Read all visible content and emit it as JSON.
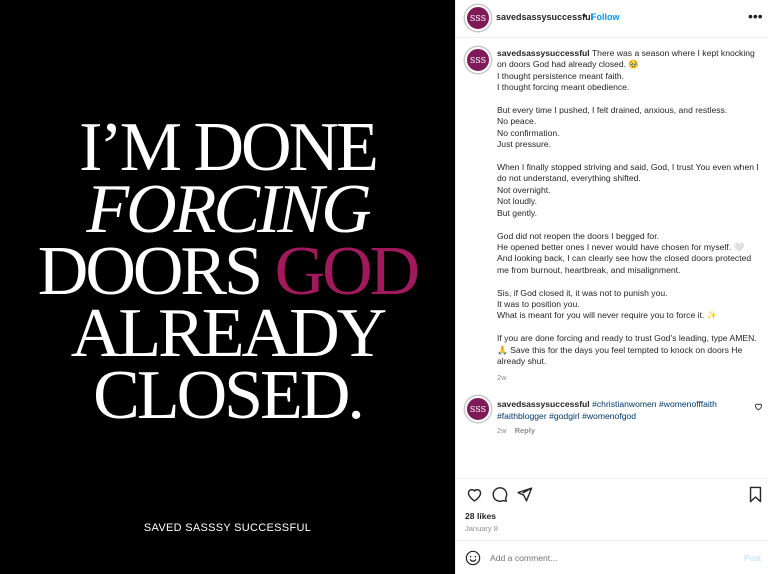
{
  "media": {
    "headline_lines": [
      "I’M DONE",
      "FORCING",
      "DOORS ",
      "GOD",
      "ALREADY",
      "CLOSED."
    ],
    "footer": "SAVED SASSSY SUCCESSFUL",
    "accent_color": "#a0195d"
  },
  "header": {
    "avatar_initials": "SSS",
    "username": "savedsassysuccessful",
    "separator": "•",
    "follow_label": "Follow",
    "more_icon": "more-horizontal-icon"
  },
  "caption": {
    "username": "savedsassysuccessful",
    "text": " There was a season where I kept knocking on doors God had already closed. 🥹\nI thought persistence meant faith.\nI thought forcing meant obedience.\n\nBut every time I pushed, I felt drained, anxious, and restless.\nNo peace.\nNo confirmation.\nJust pressure.\n\nWhen I finally stopped striving and said, God, I trust You even when I do not understand, everything shifted.\nNot overnight.\nNot loudly.\nBut gently.\n\nGod did not reopen the doors I begged for.\nHe opened better ones I never would have chosen for myself. 🤍\nAnd looking back, I can clearly see how the closed doors protected me from burnout, heartbreak, and misalignment.\n\nSis, if God closed it, it was not to punish you.\nIt was to position you.\nWhat is meant for you will never require you to force it. ✨\n\nIf you are done forcing and ready to trust God’s leading, type AMEN. 🙏 Save this for the days you feel tempted to knock on doors He already shut.",
    "time": "2w"
  },
  "reply": {
    "username": "savedsassysuccessful",
    "hashtags": [
      "#christianwomen",
      "#womenofffaith",
      "#faithblogger",
      "#godgirl",
      "#womenofgod"
    ],
    "time": "2w",
    "reply_label": "Reply"
  },
  "actions": {
    "likes": "28 likes",
    "date": "January 8",
    "icons": [
      "heart-icon",
      "comment-icon",
      "share-icon",
      "bookmark-icon"
    ]
  },
  "add_comment": {
    "placeholder": "Add a comment...",
    "post_label": "Post"
  }
}
